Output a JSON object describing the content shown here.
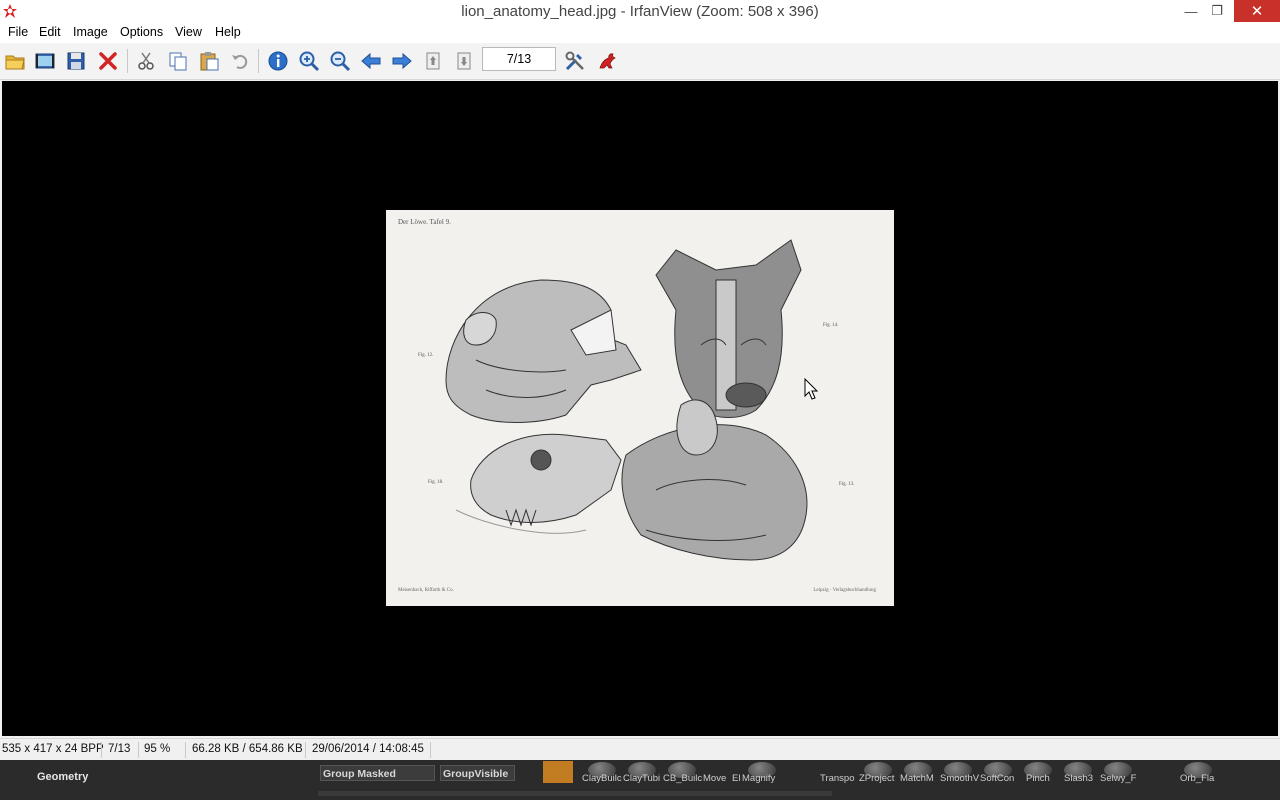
{
  "window": {
    "title": "lion_anatomy_head.jpg - IrfanView (Zoom: 508 x 396)",
    "minimize_glyph": "—",
    "restore_glyph": "❐",
    "close_glyph": "✕"
  },
  "menu": [
    "File",
    "Edit",
    "Image",
    "Options",
    "View",
    "Help"
  ],
  "toolbar": {
    "icons": [
      "open-folder-icon",
      "slideshow-icon",
      "save-icon",
      "delete-icon",
      "cut-icon",
      "copy-icon",
      "paste-icon",
      "undo-icon",
      "info-icon",
      "zoom-in-icon",
      "zoom-out-icon",
      "previous-icon",
      "next-icon",
      "first-page-icon",
      "last-page-icon",
      "settings-icon",
      "irfanview-logo-icon"
    ],
    "page_indicator": "7/13"
  },
  "image": {
    "header": "Der Löwe. Tafel 9.",
    "figure_labels": [
      "Fig. 12.",
      "Fig. 14.",
      "Fig. 18.",
      "Fig. 13."
    ],
    "footer_left": "Meisenbach, Riffarth & Co.",
    "footer_right": "Leipzig · Verlagsbuchhandlung"
  },
  "status": {
    "dimensions": "535 x 417 x 24 BPP",
    "page": "7/13",
    "zoom": "95 %",
    "size": "66.28 KB / 654.86 KB",
    "datetime": "29/06/2014 / 14:08:45"
  },
  "dock": {
    "geometry_label": "Geometry",
    "group_masked": "Group  Masked",
    "group_visible": "GroupVisible",
    "brushes": [
      "ClayBuilc",
      "ClayTubi",
      "CB_Builc",
      "Move",
      "El",
      "Magnify",
      "Transpo",
      "ZProject",
      "MatchM",
      "SmoothV",
      "SoftCon",
      "Pinch",
      "Slash3",
      "Selwy_F",
      "Orb_Fla"
    ]
  },
  "colors": {
    "close_button": "#c7312a",
    "viewer_background": "#000000",
    "dock_background": "#2b2b2b"
  }
}
